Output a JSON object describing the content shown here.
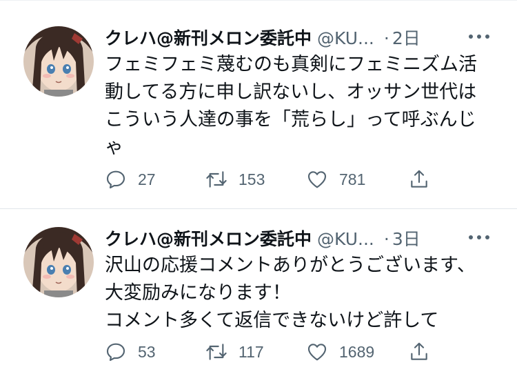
{
  "tweets": [
    {
      "author_name": "クレハ@新刊メロン委託中",
      "handle": "@KU...",
      "separator": "·",
      "time": "2日",
      "text": "フェミフェミ蔑むのも真剣にフェミニズム活\n動してる方に申し訳ないし、オッサン世代は\nこういう人達の事を「荒らし」って呼ぶんじ\nゃ",
      "replies": "27",
      "retweets": "153",
      "likes": "781"
    },
    {
      "author_name": "クレハ@新刊メロン委託中",
      "handle": "@KU...",
      "separator": "·",
      "time": "3日",
      "text": "沢山の応援コメントありがとうございます、\n大変励みになります！\nコメント多くて返信できないけど許して",
      "replies": "53",
      "retweets": "117",
      "likes": "1689"
    }
  ],
  "icons": {
    "reply": "reply-icon",
    "retweet": "retweet-icon",
    "like": "heart-icon",
    "share": "share-icon",
    "more": "more-icon"
  },
  "colors": {
    "text_primary": "#0f1419",
    "text_secondary": "#536471",
    "divider": "#e1e6ea"
  }
}
